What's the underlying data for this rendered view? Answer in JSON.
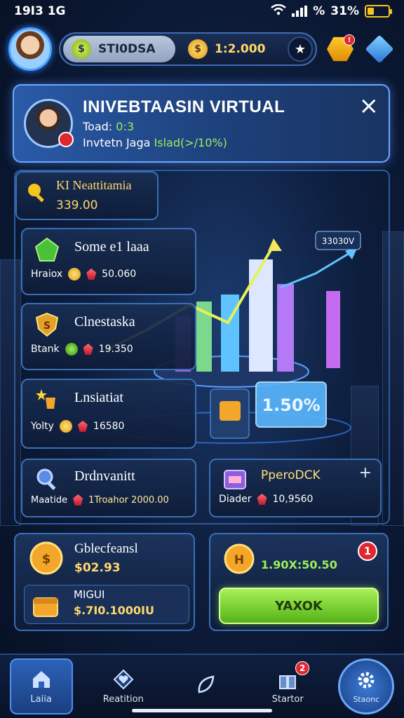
{
  "status_bar": {
    "time": "19I3 1G",
    "battery": "31%",
    "battery_level": 0.31,
    "extra": "%"
  },
  "top_bar": {
    "resource_1": "STI0DSA",
    "resource_2": "1:2.000",
    "star_label": "★"
  },
  "banner": {
    "title": "INIVEBTAASIN VIRTUAL",
    "line1_label": "Toad:",
    "line1_value": "0:3",
    "line2_label": "Invtetn Jaga",
    "line2_value": "Islad(>/10%)",
    "close": "×"
  },
  "cards": {
    "top_left": {
      "title": "KI Neattitamia",
      "value": "339.00"
    },
    "card1": {
      "title": "Some e1 laaa",
      "label": "Hraiox",
      "value": "50.060"
    },
    "card2": {
      "title": "Clnestaska",
      "label": "Btank",
      "value": "19.350"
    },
    "card3": {
      "title": "Lnsiatiat",
      "label": "Yolty",
      "value": "16580"
    },
    "card4": {
      "title": "Drdnvanitt",
      "label": "Maatide",
      "value": "1Troahor 2000.00"
    },
    "card5": {
      "title": "PperoDCK",
      "label": "Diader",
      "value": "10,9560",
      "plus": "+"
    }
  },
  "chart_panel": {
    "big_value": "1.50%",
    "tag_value": "33030V"
  },
  "bottom": {
    "left_title": "Gblecfeansl",
    "left_value": "$02.93",
    "left_sub_title": "MIGUI",
    "left_sub_value": "$.7I0.1000IU",
    "right_value": "1.90X:50.50",
    "right_badge": "1",
    "claim_button": "YAXOK"
  },
  "nav": {
    "items": [
      {
        "label": "Laiia",
        "icon": "home-icon"
      },
      {
        "label": "Reatition",
        "icon": "heart-shield-icon"
      },
      {
        "label": "",
        "icon": "leaf-icon"
      },
      {
        "label": "Startor",
        "icon": "gift-box-icon",
        "badge": "2"
      },
      {
        "label": "Staonc",
        "icon": "gear-icon"
      }
    ]
  },
  "colors": {
    "accent_blue": "#4da3ff",
    "accent_green": "#8fe44a",
    "gold": "#f6c41c",
    "badge_red": "#e0262f"
  }
}
